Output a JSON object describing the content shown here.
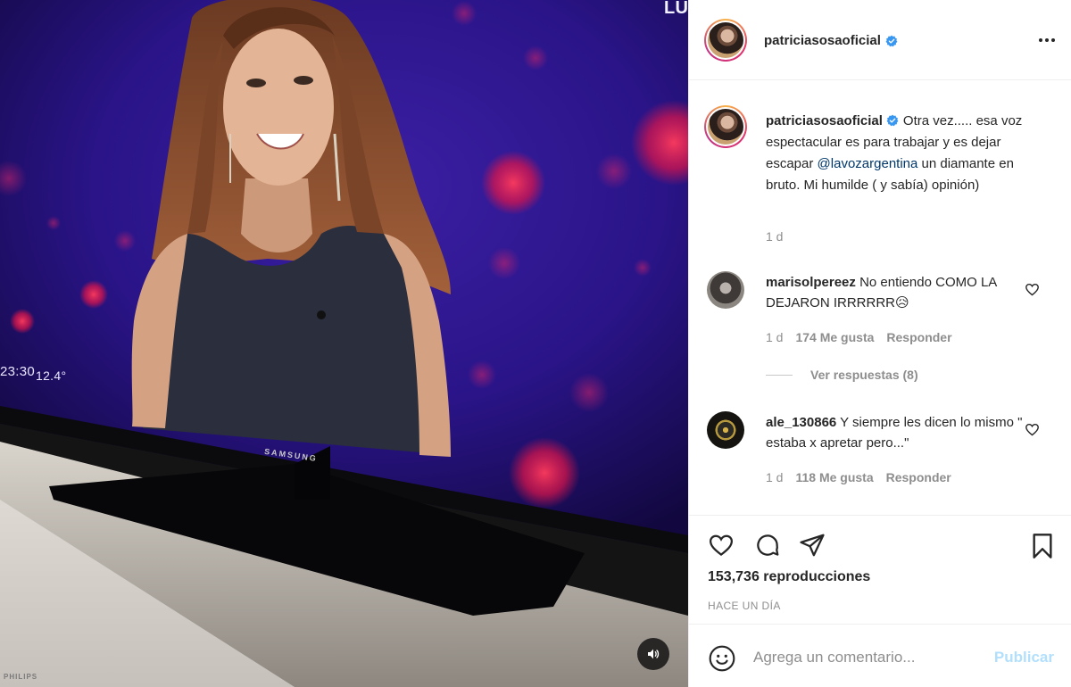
{
  "media": {
    "tv_time": "23:30",
    "tv_temp": "12.4°",
    "tv_corner": "LU",
    "tv_brand": "SAMSUNG",
    "stand_brand": "PHILIPS",
    "sound_icon": "speaker-icon"
  },
  "post": {
    "username": "patriciasosaoficial",
    "verified": true,
    "more_icon": "more-horizontal-icon"
  },
  "caption": {
    "username": "patriciasosaoficial",
    "text_before": "Otra vez..... esa voz espectacular es para trabajar y es dejar escapar ",
    "mention": "@lavozargentina",
    "text_after": " un diamante en bruto. Mi humilde ( y sabía) opinión)",
    "time": "1 d"
  },
  "comments": [
    {
      "username": "marisolpereez",
      "text": "No entiendo COMO LA DEJARON IRRRRRR😥",
      "time": "1 d",
      "likes": "174 Me gusta",
      "reply": "Responder",
      "view_replies": "Ver respuestas (8)"
    },
    {
      "username": "ale_130866",
      "text": "Y siempre les dicen lo mismo \" estaba x apretar pero...\"",
      "time": "1 d",
      "likes": "118 Me gusta",
      "reply": "Responder"
    }
  ],
  "actions": {
    "views": "153,736 reproducciones",
    "ago": "HACE UN DÍA",
    "icons": [
      "heart-icon",
      "comment-icon",
      "share-icon",
      "bookmark-icon"
    ]
  },
  "comment_box": {
    "placeholder": "Agrega un comentario...",
    "publish": "Publicar",
    "emoji_icon": "emoji-icon"
  },
  "colors": {
    "verified": "#3897f0",
    "mention": "#00376b",
    "publish_disabled": "#b2dffc",
    "muted": "#8e8e8e"
  }
}
